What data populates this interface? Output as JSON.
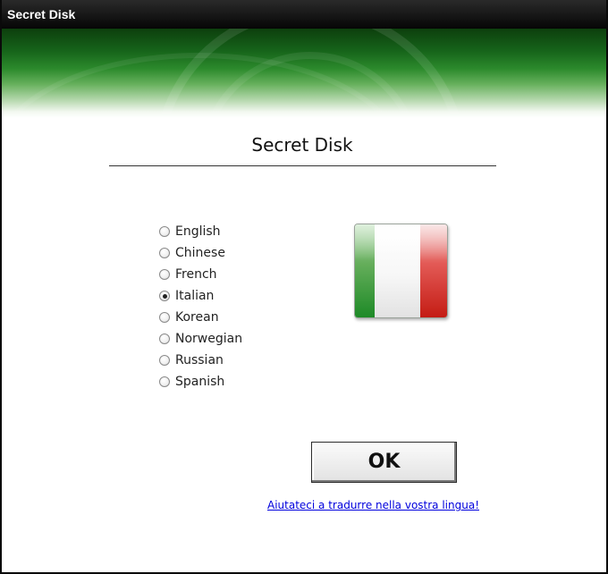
{
  "window": {
    "title": "Secret Disk"
  },
  "dialog": {
    "heading": "Secret Disk"
  },
  "languages": [
    {
      "label": "English",
      "selected": false
    },
    {
      "label": "Chinese",
      "selected": false
    },
    {
      "label": "French",
      "selected": false
    },
    {
      "label": "Italian",
      "selected": true
    },
    {
      "label": "Korean",
      "selected": false
    },
    {
      "label": "Norwegian",
      "selected": false
    },
    {
      "label": "Russian",
      "selected": false
    },
    {
      "label": "Spanish",
      "selected": false
    }
  ],
  "flag": {
    "icon": "italy-flag-icon",
    "colors": [
      "#1e8a27",
      "#ffffff",
      "#c41c14"
    ]
  },
  "buttons": {
    "ok_label": "OK"
  },
  "help_link": {
    "text": "Aiutateci a tradurre nella vostra lingua!"
  },
  "theme": {
    "banner_green": "#16641a",
    "link_blue": "#0000dd"
  }
}
